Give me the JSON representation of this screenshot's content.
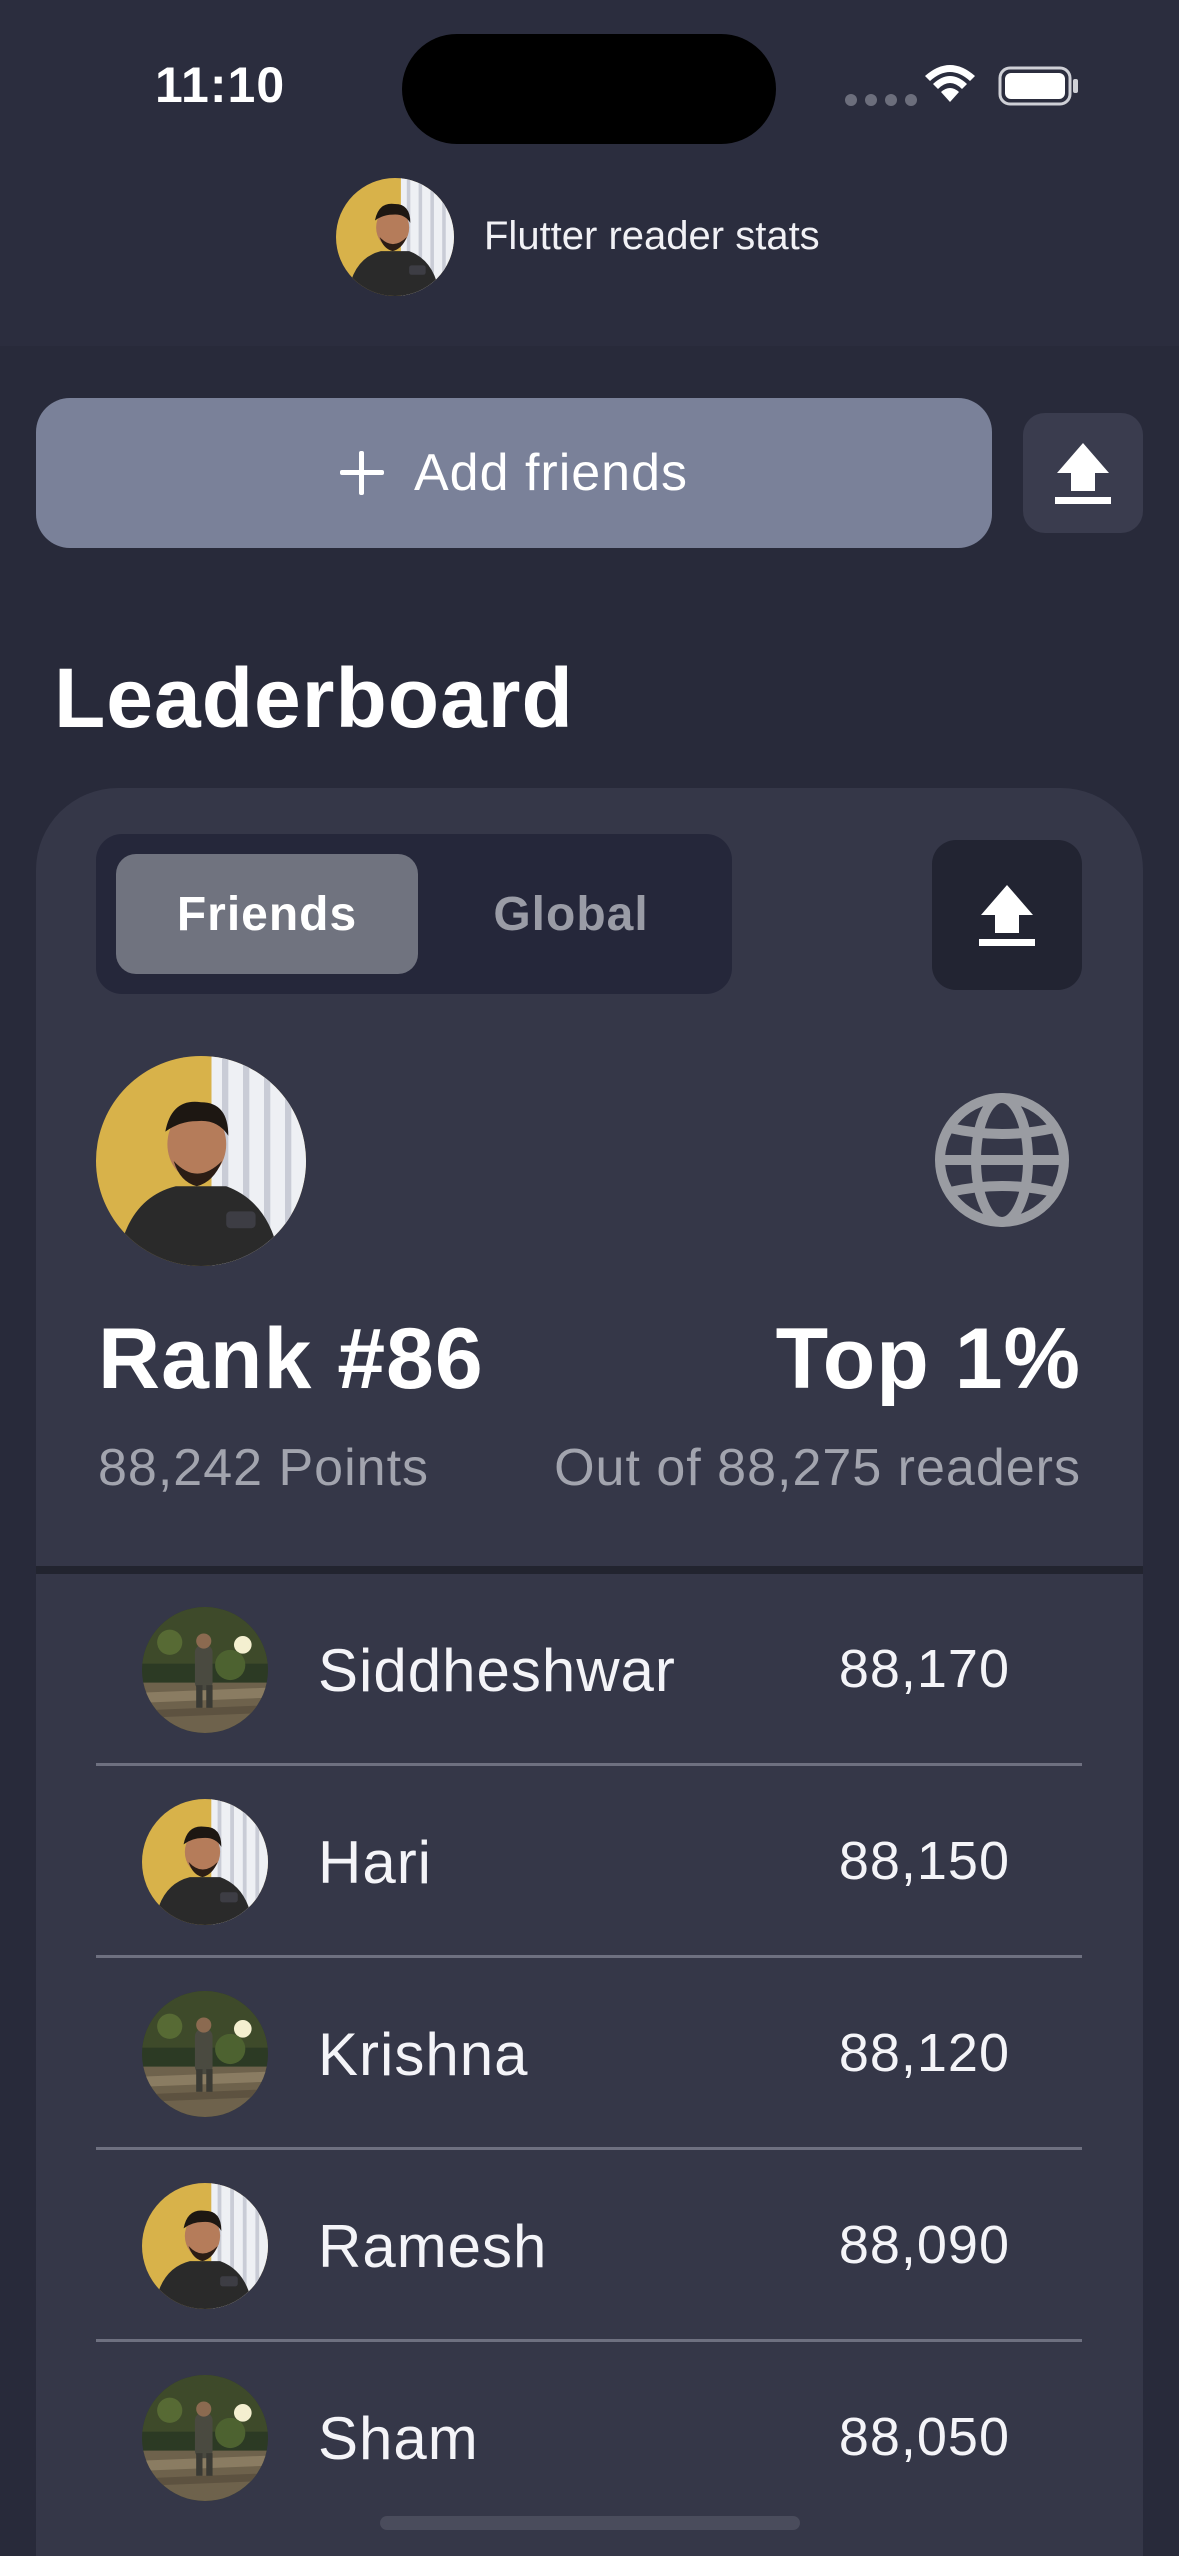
{
  "status_bar": {
    "time": "11:10"
  },
  "header": {
    "title": "Flutter reader stats",
    "avatar_icon": "user-photo"
  },
  "actions": {
    "add_friends_label": "Add friends",
    "share_icon": "upload-share-icon"
  },
  "leaderboard": {
    "title": "Leaderboard",
    "tabs": [
      {
        "label": "Friends",
        "selected": true
      },
      {
        "label": "Global",
        "selected": false
      }
    ],
    "me": {
      "rank": "Rank #86",
      "percentile": "Top 1%",
      "points": "88,242 Points",
      "out_of": "Out of 88,275 readers"
    },
    "entries": [
      {
        "name": "Siddheshwar",
        "score": "88,170",
        "photo": "outdoor"
      },
      {
        "name": "Hari",
        "score": "88,150",
        "photo": "indoor"
      },
      {
        "name": "Krishna",
        "score": "88,120",
        "photo": "outdoor"
      },
      {
        "name": "Ramesh",
        "score": "88,090",
        "photo": "indoor"
      },
      {
        "name": "Sham",
        "score": "88,050",
        "photo": "outdoor"
      }
    ]
  },
  "colors": {
    "background": "#282a3a",
    "card": "#353748",
    "accent_button": "#7a8199",
    "segment_selected": "#70737f"
  }
}
